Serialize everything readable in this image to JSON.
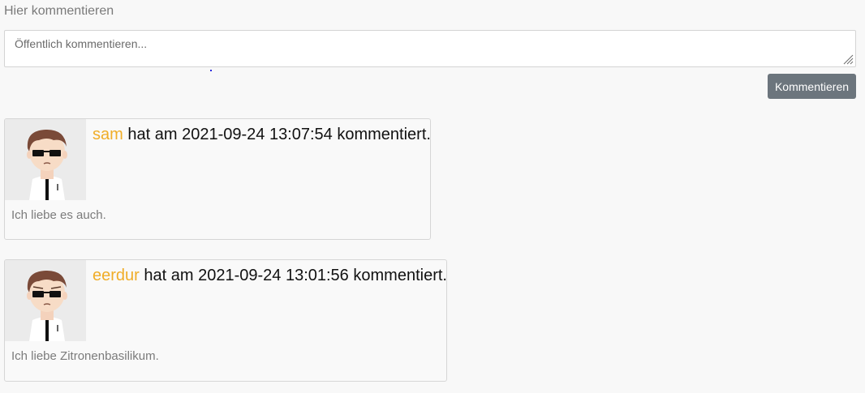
{
  "form": {
    "heading": "Hier kommentieren",
    "placeholder": "Öffentlich kommentieren...",
    "submit_label": "Kommentieren"
  },
  "comments": [
    {
      "user": "sam",
      "text_prefix": "hat am",
      "timestamp": "2021-09-24 13:07:54",
      "text_suffix": "kommentiert.",
      "body": "Ich liebe es auch."
    },
    {
      "user": "eerdur",
      "text_prefix": "hat am",
      "timestamp": "2021-09-24 13:01:56",
      "text_suffix": "kommentiert.",
      "body": "Ich liebe Zitronenbasilikum."
    }
  ],
  "icons": {
    "avatar": "avatar-icon",
    "resize": "resize-grip-icon"
  },
  "colors": {
    "username": "#f0ad28",
    "button": "#6c757d",
    "background": "#f8f8f8"
  }
}
